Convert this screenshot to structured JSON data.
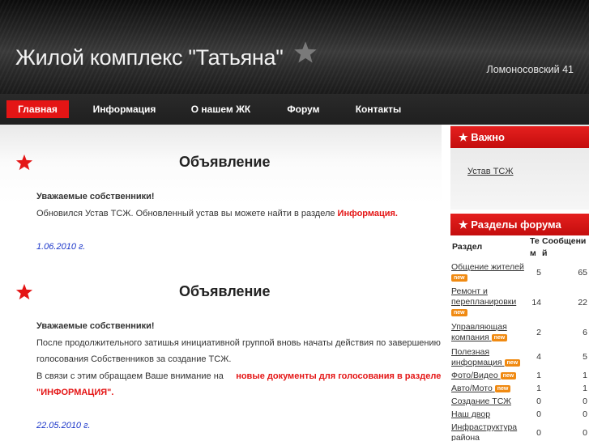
{
  "header": {
    "site_title": "Жилой комплекс \"Татьяна\"",
    "address": "Ломоносовский 41",
    "star_icon": "star-icon"
  },
  "nav": {
    "items": [
      {
        "label": "Главная",
        "active": true
      },
      {
        "label": "Информация"
      },
      {
        "label": "О нашем ЖК"
      },
      {
        "label": "Форум"
      },
      {
        "label": "Контакты"
      }
    ]
  },
  "posts": [
    {
      "title": "Объявление",
      "greeting": "Уважаемые собственники!",
      "text1_before": "Обновился Устав ТСЖ. Обновленный устав вы можете найти в разделе ",
      "text1_link": "Информация.",
      "date": "1.06.2010 г."
    },
    {
      "title": "Объявление",
      "greeting": "Уважаемые собственники!",
      "line1": "После продолжительного затишья инициативной группой вновь начаты действия по завершению",
      "line2": "голосования Собственников за создание ТСЖ.",
      "line3_before": "В связи с этим обращаем Ваше внимание на ",
      "line3_link": "новые документы для голосования в разделе",
      "line4_link": "\"ИНФОРМАЦИЯ\".",
      "date": "22.05.2010 г."
    }
  ],
  "sidebar": {
    "important": {
      "heading": "★ Важно",
      "link": "Устав ТСЖ"
    },
    "forum": {
      "heading": "★ Разделы форума",
      "col_section": "Раздел",
      "col_topics_1": "Те",
      "col_topics_2": "м",
      "col_messages_1": "Сообщени",
      "col_messages_2": "й",
      "badge": "new",
      "rows": [
        {
          "name1": "Общение жителей",
          "name2": "",
          "topics": "5",
          "messages": "65",
          "new": true
        },
        {
          "name1": "Ремонт и",
          "name2": "перепланировки",
          "topics": "14",
          "messages": "22",
          "new": true
        },
        {
          "name1": "Управляющая",
          "name2": "компания",
          "topics": "2",
          "messages": "6",
          "new": true
        },
        {
          "name1": "Полезная",
          "name2": "информация",
          "topics": "4",
          "messages": "5",
          "new": true
        },
        {
          "name1": "Фото/Видео",
          "name2": "",
          "topics": "1",
          "messages": "1",
          "new": true
        },
        {
          "name1": "Авто/Мото",
          "name2": "",
          "topics": "1",
          "messages": "1",
          "new": true
        },
        {
          "name1": "Создание ТСЖ",
          "name2": "",
          "topics": "0",
          "messages": "0",
          "new": false
        },
        {
          "name1": "Наш двор",
          "name2": "",
          "topics": "0",
          "messages": "0",
          "new": false
        },
        {
          "name1": "Инфраструктура",
          "name2": "района",
          "topics": "0",
          "messages": "0",
          "new": false
        }
      ]
    }
  }
}
